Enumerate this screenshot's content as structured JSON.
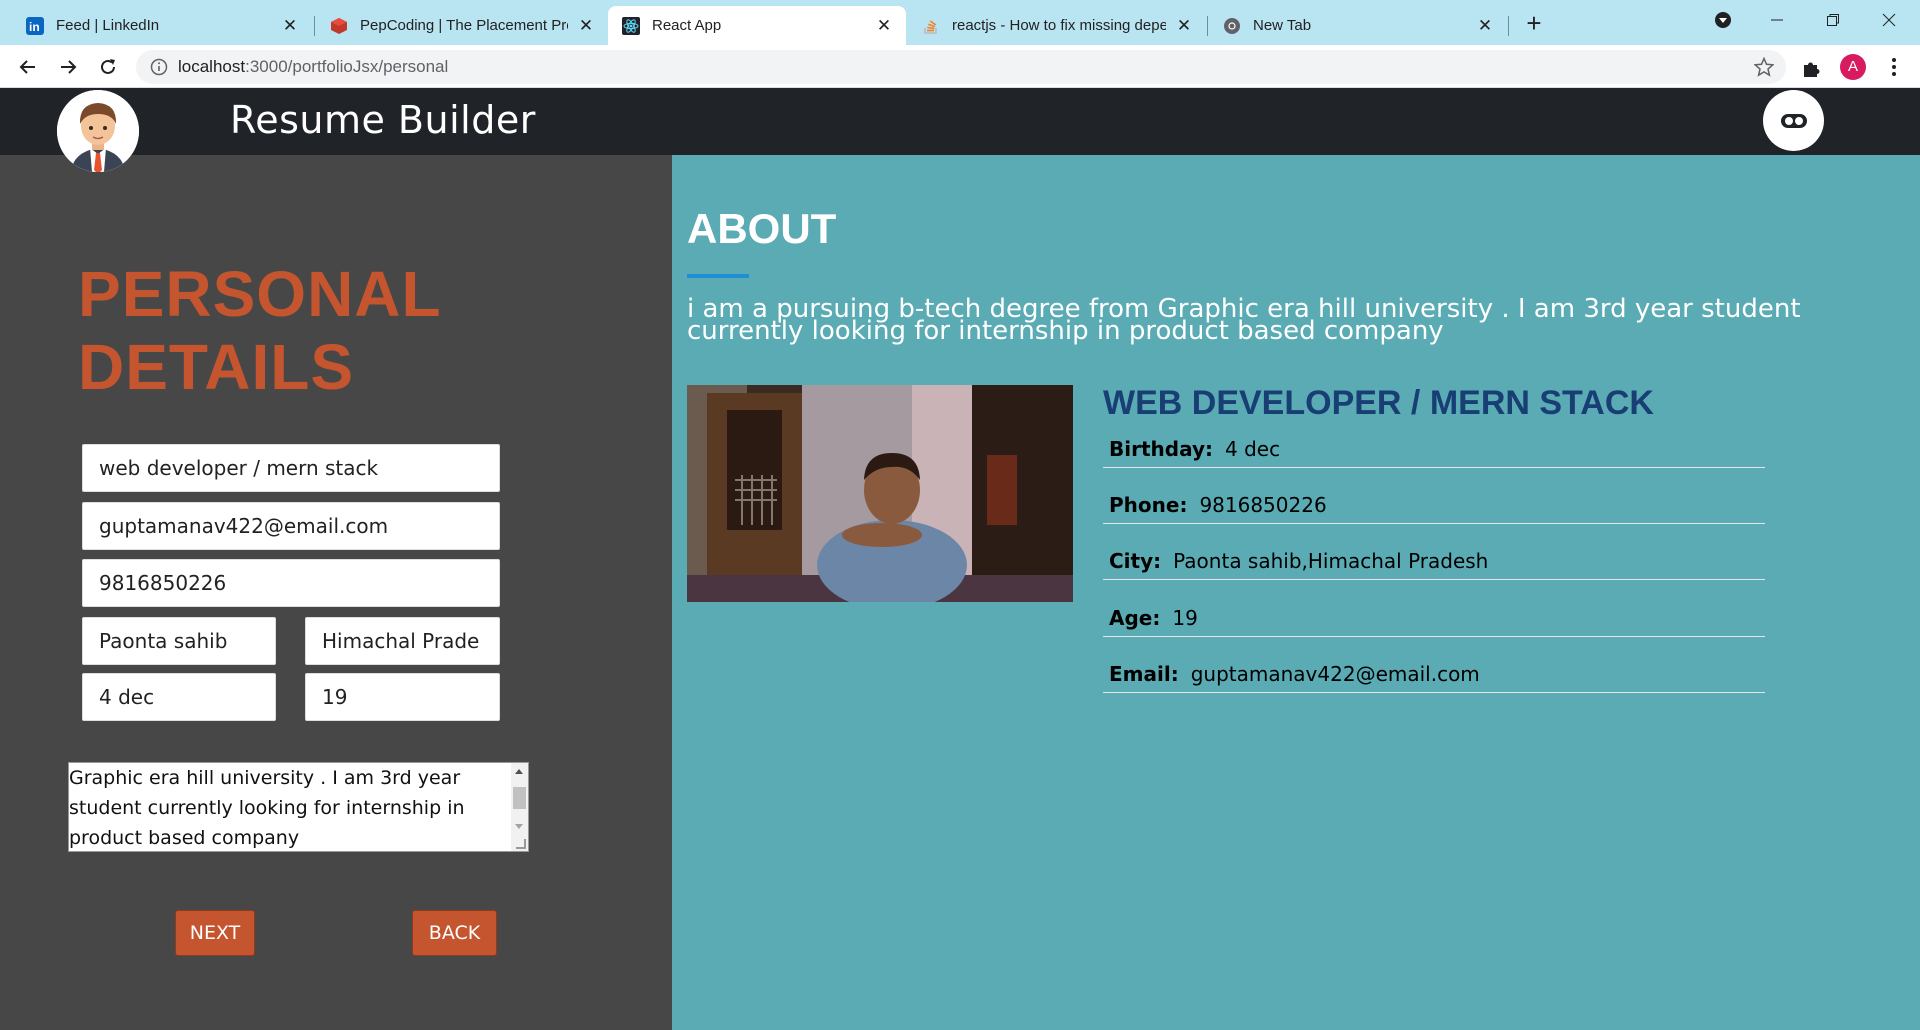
{
  "browser": {
    "tabs": [
      {
        "title": "Feed | LinkedIn",
        "icon": "linkedin-icon"
      },
      {
        "title": "PepCoding | The Placement Prog",
        "icon": "pepcoding-icon"
      },
      {
        "title": "React App",
        "icon": "react-icon"
      },
      {
        "title": "reactjs - How to fix missing depe",
        "icon": "stackoverflow-icon"
      },
      {
        "title": "New Tab",
        "icon": "chrome-icon"
      }
    ],
    "active_tab_index": 2,
    "url_host": "localhost",
    "url_rest": ":3000/portfolioJsx/personal",
    "profile_initial": "A"
  },
  "app": {
    "title": "Resume Builder"
  },
  "form": {
    "heading_line1": "PERSONAL",
    "heading_line2": "DETAILS",
    "role": "web developer / mern stack",
    "email": "guptamanav422@email.com",
    "phone": "9816850226",
    "city": "Paonta sahib",
    "state": "Himachal Prade",
    "birthday": "4 dec",
    "age": "19",
    "about": "Graphic era hill university . I am 3rd year student currently looking for internship in product based company",
    "next_label": "NEXT",
    "back_label": "BACK"
  },
  "preview": {
    "about_heading": "ABOUT",
    "about_text": "i am a pursuing b-tech degree from Graphic era hill university . I am 3rd year student currently looking for internship in product based company",
    "role": "WEB DEVELOPER / MERN STACK",
    "rows": [
      {
        "label": "Birthday:",
        "value": "4 dec"
      },
      {
        "label": "Phone:",
        "value": "9816850226"
      },
      {
        "label": "City:",
        "value": "Paonta sahib,Himachal Pradesh"
      },
      {
        "label": "Age:",
        "value": "19"
      },
      {
        "label": "Email:",
        "value": "guptamanav422@email.com"
      }
    ]
  },
  "colors": {
    "accent_orange": "#c4552f",
    "preview_bg": "#5aabb4",
    "role_blue": "#183e74",
    "panel_dark": "#474747",
    "header_dark": "#202327"
  }
}
